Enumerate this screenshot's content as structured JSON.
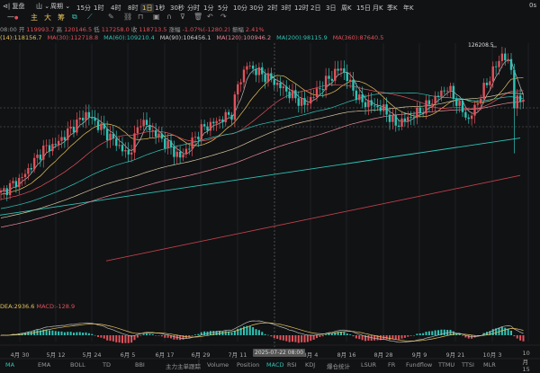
{
  "toolbar": {
    "replay": "复盘",
    "chart_type": "山",
    "period": "周期",
    "timeframes": [
      "15分",
      "1时",
      "4时",
      "8时",
      "1日",
      "1秒",
      "30秒",
      "分时",
      "1分",
      "5分",
      "10分",
      "30分",
      "2时",
      "3时",
      "12时",
      "2日",
      "3日",
      "周K",
      "15日",
      "月K",
      "季K",
      "年K"
    ],
    "active": "1日",
    "countdown": "0s"
  },
  "tools": {
    "labels": [
      "主",
      "大",
      "筹"
    ],
    "icons": [
      "line-dot-icon",
      "copy-icon",
      "ruler-icon",
      "pen-icon",
      "link-icon",
      "lock-icon",
      "camera-icon",
      "magnet-icon",
      "filter-icon",
      "trash-icon",
      "undo-icon",
      "redo-icon"
    ]
  },
  "ohlc": {
    "time": "08:00",
    "open_l": "开",
    "open": "119993.7",
    "high_l": "高",
    "high": "120146.5",
    "low_l": "低",
    "low": "117258.0",
    "close_l": "收",
    "close": "118713.5",
    "chg_l": "涨幅",
    "chg": "-1.07%(-1280.2)",
    "amp_l": "振幅",
    "amp": "2.41%"
  },
  "ma_legend": [
    {
      "t": "(14):118156.7",
      "c": "#e6c35a"
    },
    {
      "t": "MA(30):112718.8",
      "c": "#e0525a"
    },
    {
      "t": "MA(60):109210.4",
      "c": "#2ec4b6"
    },
    {
      "t": "MA(90):106456.1",
      "c": "#cccccc"
    },
    {
      "t": "MA(120):100946.2",
      "c": "#e88a9a"
    },
    {
      "t": "MA(200):98115.9",
      "c": "#2ec4b6"
    },
    {
      "t": "MA(360):87640.5",
      "c": "#e0525a"
    }
  ],
  "high_label": "126208.5",
  "macd_legend": {
    "dea": "DEA:2936.6",
    "macd": "MACD:-128.9"
  },
  "crosshair_label": "2025-07-22 08:00",
  "dates": [
    "4月 30",
    "5月 12",
    "5月 24",
    "6月 5",
    "6月 17",
    "6月 29",
    "7月 11",
    "8月 4",
    "8月 16",
    "8月 28",
    "9月 9",
    "9月 21",
    "10月 3",
    "10月 15"
  ],
  "tabs_left": [
    "MA",
    "EMA",
    "BOLL",
    "TD",
    "BBI",
    "主力主单跟踪"
  ],
  "tabs_right": [
    "Volume",
    "Position",
    "MACD",
    "RSI",
    "KDJ",
    "爆仓统计",
    "LSUR",
    "FR",
    "Fundflow",
    "TTMU",
    "TTSI",
    "MLR"
  ],
  "colors": {
    "up": "#e0525a",
    "down": "#2ec4b6",
    "accent": "#2ec4b6"
  },
  "chart_data": {
    "type": "candlestick",
    "start": "2025-04-24",
    "end": "2025-10-13",
    "keypoints": [
      [
        "04-24",
        93000
      ],
      [
        "05-01",
        96500
      ],
      [
        "05-08",
        103000
      ],
      [
        "05-12",
        104000
      ],
      [
        "05-22",
        111000
      ],
      [
        "05-26",
        108500
      ],
      [
        "06-05",
        101500
      ],
      [
        "06-09",
        109500
      ],
      [
        "06-17",
        104500
      ],
      [
        "06-22",
        101000
      ],
      [
        "06-29",
        107500
      ],
      [
        "07-09",
        111000
      ],
      [
        "07-11",
        117500
      ],
      [
        "07-14",
        122000
      ],
      [
        "07-22",
        118700
      ],
      [
        "08-02",
        113000
      ],
      [
        "08-10",
        119000
      ],
      [
        "08-14",
        121500
      ],
      [
        "08-20",
        114000
      ],
      [
        "08-28",
        112000
      ],
      [
        "09-01",
        108500
      ],
      [
        "09-09",
        111500
      ],
      [
        "09-18",
        117000
      ],
      [
        "09-25",
        109500
      ],
      [
        "10-01",
        118000
      ],
      [
        "10-06",
        124500
      ],
      [
        "10-09",
        121500
      ],
      [
        "10-10",
        113000
      ],
      [
        "10-13",
        115000
      ]
    ],
    "crash_low": {
      "date": "10-10",
      "low": 102000
    },
    "high": 126208.5,
    "ma200": [
      88000,
      105500
    ],
    "ma360": [
      77600,
      97000
    ]
  }
}
